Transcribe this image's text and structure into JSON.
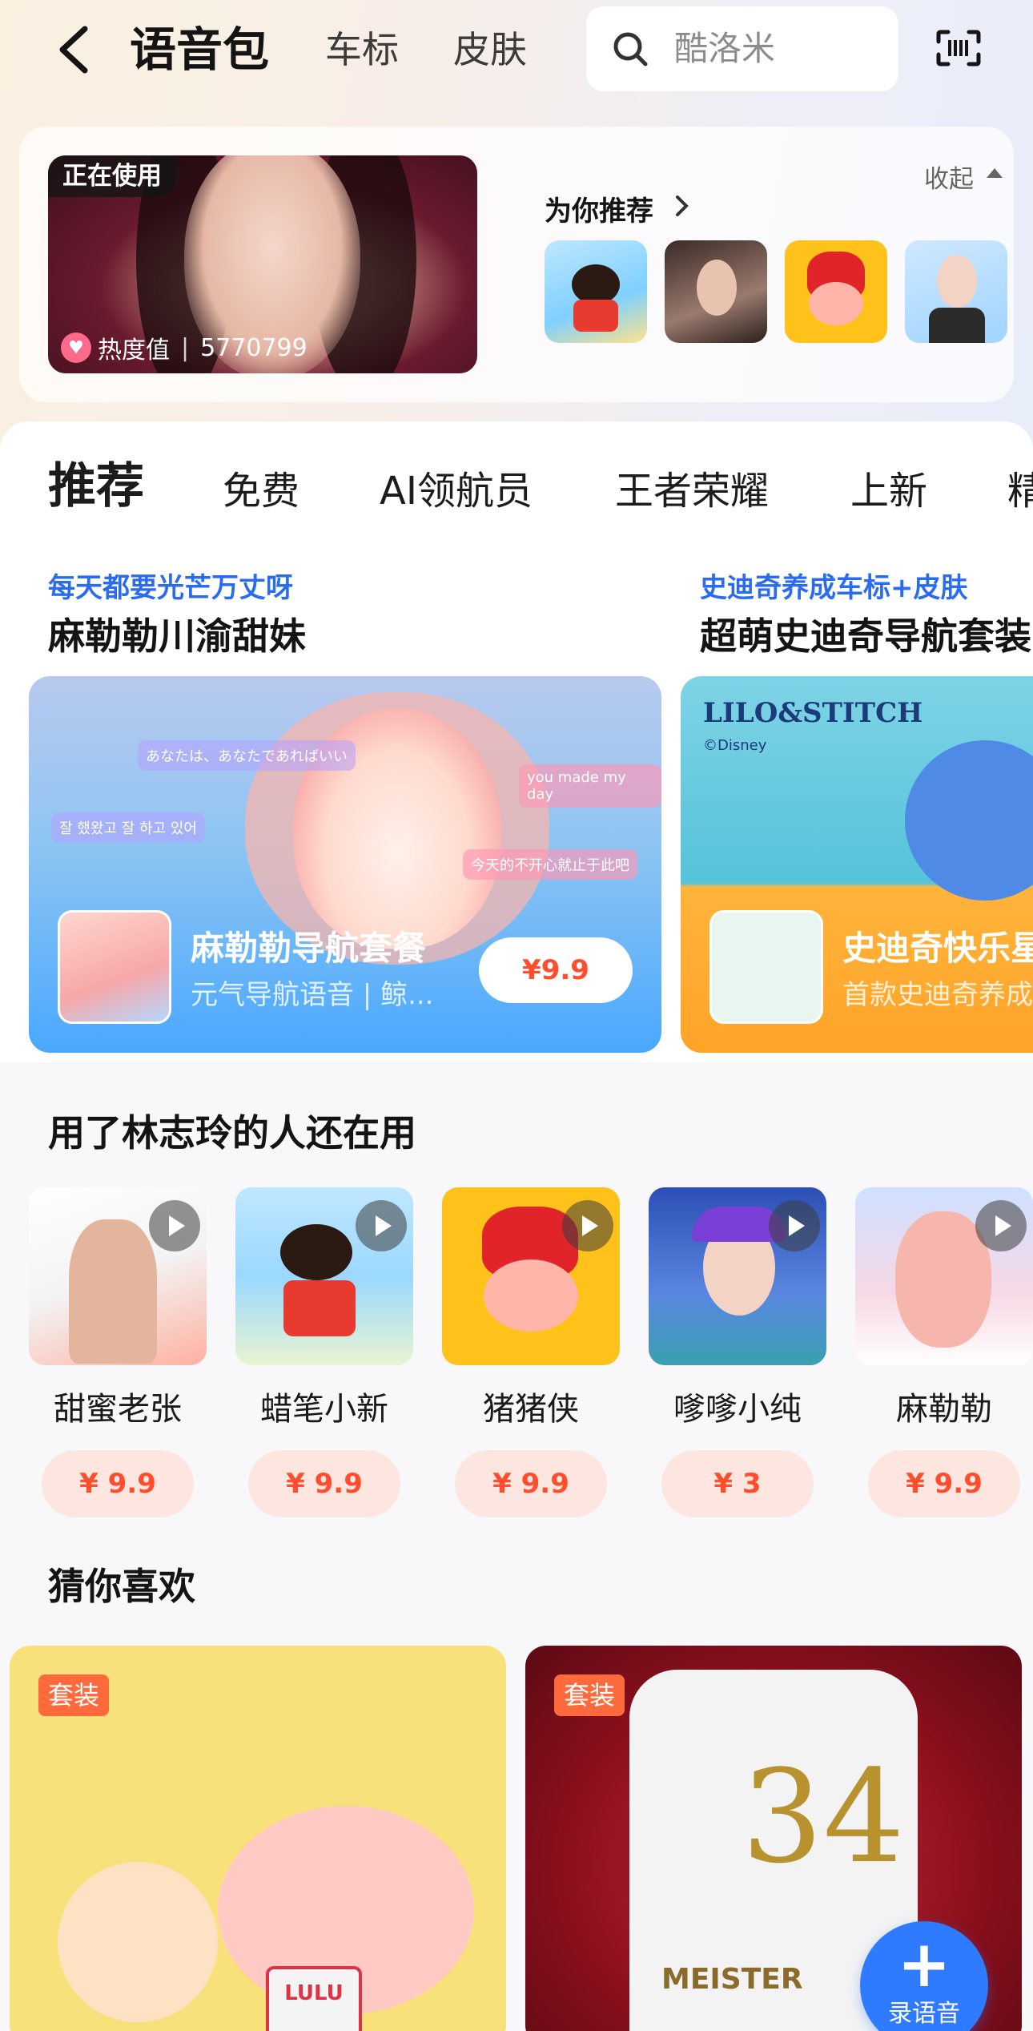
{
  "header": {
    "title": "语音包",
    "tabs": [
      "车标",
      "皮肤"
    ],
    "search_placeholder": "酷洛米"
  },
  "current": {
    "badge": "正在使用",
    "heat_label": "热度值",
    "heat_value": "5770799",
    "recommend_title": "为你推荐",
    "collapse_label": "收起"
  },
  "categories": [
    "推荐",
    "免费",
    "AI领航员",
    "王者荣耀",
    "上新",
    "精"
  ],
  "promos": [
    {
      "subtitle": "每天都要光芒万丈呀",
      "title": "麻勒勒川渝甜妹",
      "name": "麻勒勒导航套餐",
      "desc": "元气导航语音 | 鲸...",
      "price": "¥9.9",
      "bubbles": [
        "あなたは、あなたであればいい",
        "잘 했왔고 잘 하고 있어",
        "you made my day",
        "今天的不开心就止于此吧"
      ]
    },
    {
      "subtitle": "史迪奇养成车标+皮肤",
      "title": "超萌史迪奇导航套装",
      "name": "史迪奇快乐星",
      "desc": "首款史迪奇养成",
      "logo": "LILO&STITCH",
      "logo_sub": "©Disney"
    }
  ],
  "also_used": {
    "title": "用了林志玲的人还在用",
    "items": [
      {
        "name": "甜蜜老张",
        "price": "¥ 9.9"
      },
      {
        "name": "蜡笔小新",
        "price": "¥ 9.9"
      },
      {
        "name": "猪猪侠",
        "price": "¥ 9.9"
      },
      {
        "name": "嗲嗲小纯",
        "price": "¥ 3"
      },
      {
        "name": "麻勒勒",
        "price": "¥ 9.9"
      }
    ]
  },
  "guess": {
    "title": "猜你喜欢",
    "cards": [
      {
        "tag": "套装",
        "label": "LULU"
      },
      {
        "tag": "套装",
        "shirt_number": "34",
        "shirt_text": "MEISTER"
      }
    ]
  },
  "fab": {
    "label": "录语音"
  },
  "colors": {
    "accent_blue": "#2f7bff",
    "price_red": "#ff4d2d",
    "tag_orange": "#ff6a3d",
    "promo_blue": "#2a6cf0"
  }
}
